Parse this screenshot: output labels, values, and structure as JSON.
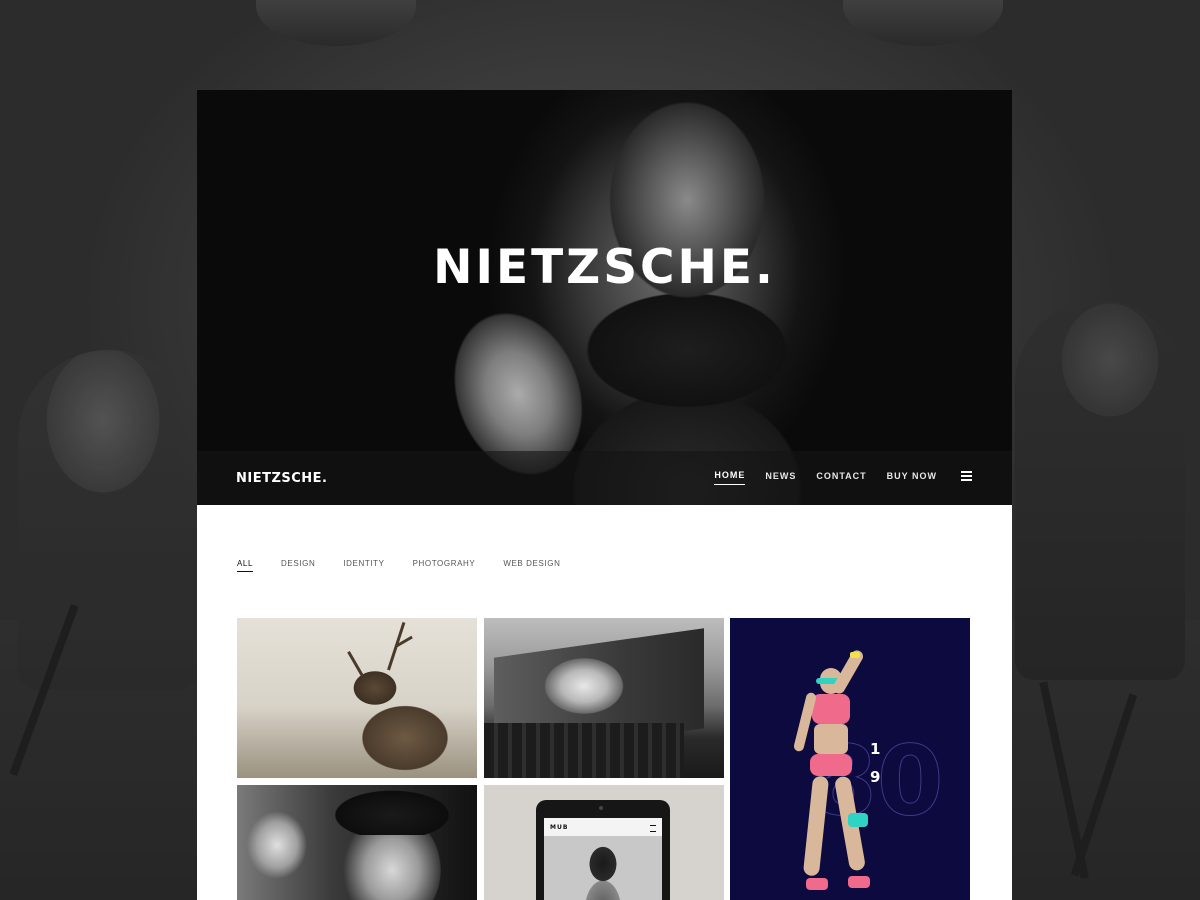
{
  "hero": {
    "title": "NIETZSCHE."
  },
  "nav": {
    "logo": "NIETZSCHE.",
    "links": [
      {
        "label": "HOME",
        "active": true
      },
      {
        "label": "NEWS",
        "active": false
      },
      {
        "label": "CONTACT",
        "active": false
      },
      {
        "label": "BUY NOW",
        "active": false
      }
    ],
    "menu_icon": "hamburger-menu-icon"
  },
  "filters": [
    {
      "label": "ALL",
      "active": true
    },
    {
      "label": "DESIGN",
      "active": false
    },
    {
      "label": "IDENTITY",
      "active": false
    },
    {
      "label": "PHOTOGRAHY",
      "active": false
    },
    {
      "label": "WEB DESIGN",
      "active": false
    }
  ],
  "portfolio": {
    "fitness_numbers": {
      "big": "80",
      "small_top": "1",
      "small_bottom": "9"
    },
    "tablet_logo": "MUB"
  },
  "colors": {
    "hero_background": "#0a0a0a",
    "page_background": "#ffffff",
    "fitness_background": "#0c0a3e",
    "accent_pink": "#f06a8c",
    "accent_teal": "#2fd3c4",
    "accent_yellow": "#f2e14a"
  }
}
